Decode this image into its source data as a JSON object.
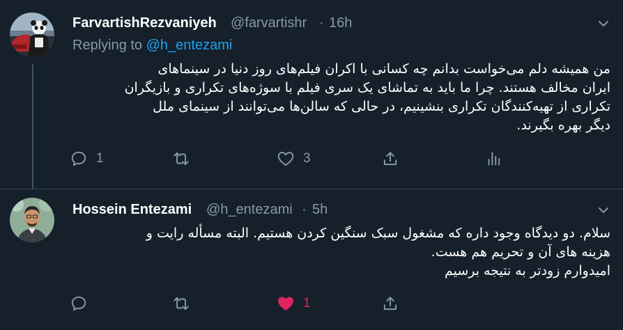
{
  "tweets": [
    {
      "display_name": "FarvartishRezvaniyeh",
      "handle": "@farvartishr",
      "time": "16h",
      "replying_to_prefix": "Replying to",
      "replying_to_handle": "@h_entezami",
      "lines": [
        "من همیشه دلم می‌خواست بدانم چه کسانی با اکران فیلم‌های روز دنیا در سینماهای",
        "ایران مخالف هستند. چرا ما باید به تماشای یک سری فیلم با سوژه‌های تکراری و بازیگران",
        "تکراری از تهیه‌کنندگان تکراری بنشینیم، در حالی که سالن‌ها می‌توانند از سینمای ملل",
        "دیگر بهره بگیرند."
      ],
      "reply_count": "1",
      "retweet_count": "",
      "like_count": "3",
      "liked": false,
      "icons": {
        "reply": "reply-icon",
        "retweet": "retweet-icon",
        "like": "heart-outline-icon",
        "share": "share-icon",
        "analytics": "analytics-icon",
        "menu": "chevron-down-icon"
      }
    },
    {
      "display_name": "Hossein Entezami",
      "handle": "@h_entezami",
      "time": "5h",
      "lines": [
        "سلام. دو دیدگاه وجود داره که مشغول سبک سنگین کردن هستیم. البته مسأله رایت و",
        "هزینه های آن و تحریم هم هست.",
        "امیدوارم زودتر به نتیجه برسیم"
      ],
      "reply_count": "",
      "retweet_count": "",
      "like_count": "1",
      "liked": true,
      "icons": {
        "reply": "reply-icon",
        "retweet": "retweet-icon",
        "like": "heart-filled-icon",
        "share": "share-icon",
        "menu": "chevron-down-icon"
      }
    }
  ],
  "colors": {
    "background": "#15202b",
    "secondary_text": "#8899a6",
    "link": "#1da1f2",
    "like_active": "#e0245e",
    "divider": "#38444d"
  }
}
